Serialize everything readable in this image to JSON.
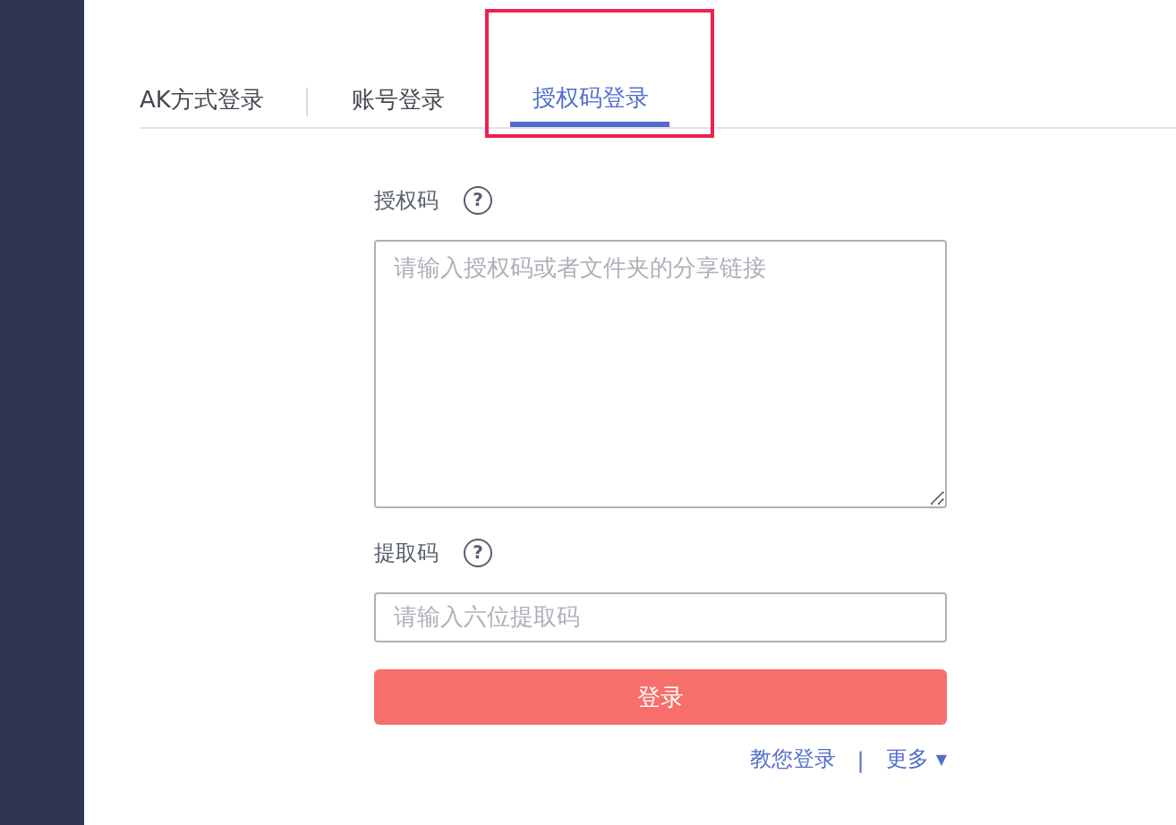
{
  "tabs": [
    {
      "label": "AK方式登录",
      "selected": false,
      "highlighted": false
    },
    {
      "label": "账号登录",
      "selected": false,
      "highlighted": false
    },
    {
      "label": "授权码登录",
      "selected": true,
      "highlighted": true
    }
  ],
  "form": {
    "auth_label": "授权码",
    "help": "?",
    "auth_placeholder": "请输入授权码或者文件夹的分享链接",
    "code_label": "提取码",
    "code_help": "?",
    "code_placeholder": "请输入六位提取码",
    "submit": "登录"
  },
  "links": {
    "help": "教您登录",
    "separator": "|",
    "more": "更多",
    "more_caret": "▼"
  }
}
